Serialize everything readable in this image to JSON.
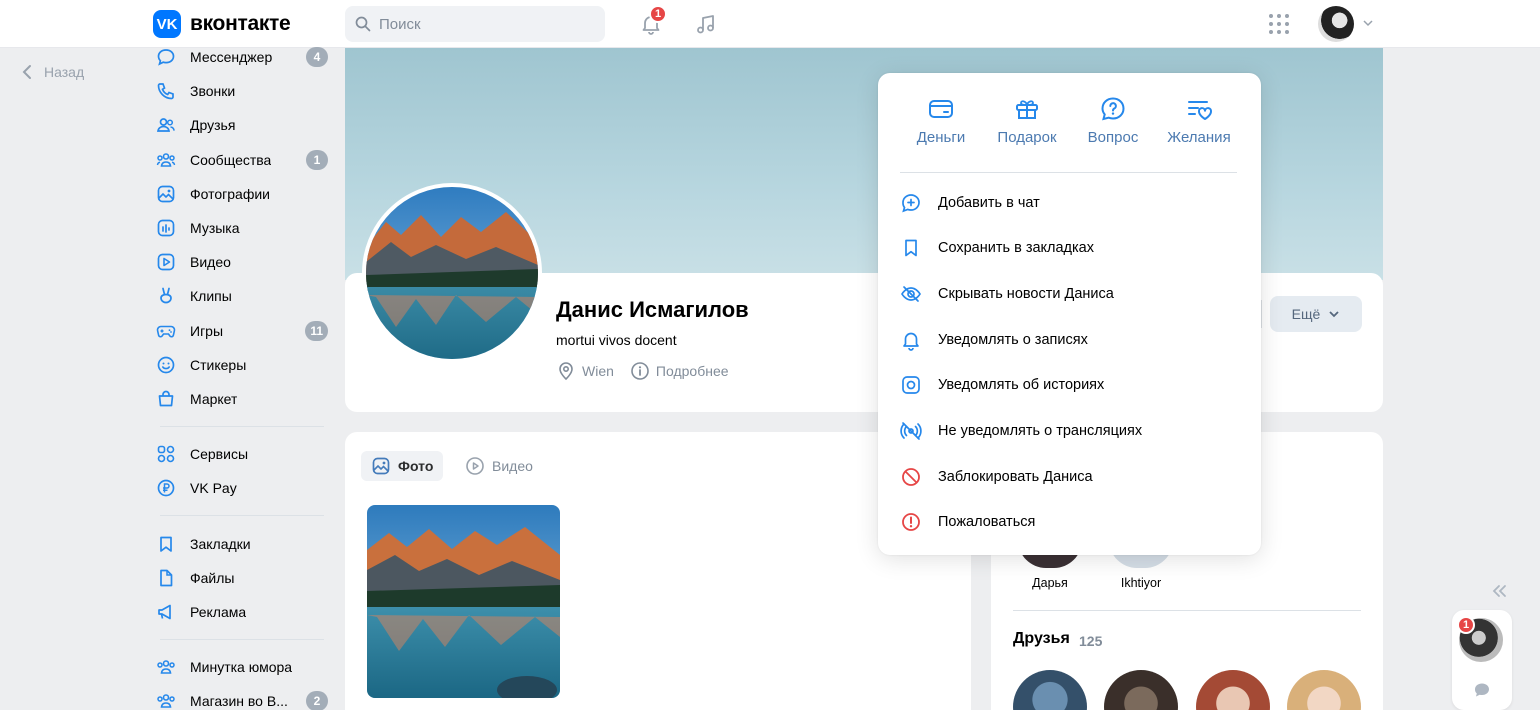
{
  "header": {
    "logo_mark": "VK",
    "logo_text": "вконтакте",
    "search_placeholder": "Поиск",
    "notifications_count": "1"
  },
  "back_label": "Назад",
  "sidebar": {
    "items": [
      {
        "label": "Мессенджер",
        "count": "4",
        "icon": "message-icon"
      },
      {
        "label": "Звонки",
        "count": "",
        "icon": "phone-icon"
      },
      {
        "label": "Друзья",
        "count": "",
        "icon": "friends-icon"
      },
      {
        "label": "Сообщества",
        "count": "1",
        "icon": "communities-icon"
      },
      {
        "label": "Фотографии",
        "count": "",
        "icon": "photo-icon"
      },
      {
        "label": "Музыка",
        "count": "",
        "icon": "music-icon"
      },
      {
        "label": "Видео",
        "count": "",
        "icon": "video-icon"
      },
      {
        "label": "Клипы",
        "count": "",
        "icon": "clips-icon"
      },
      {
        "label": "Игры",
        "count": "11",
        "icon": "games-icon"
      },
      {
        "label": "Стикеры",
        "count": "",
        "icon": "stickers-icon"
      },
      {
        "label": "Маркет",
        "count": "",
        "icon": "market-icon"
      }
    ],
    "services": [
      {
        "label": "Сервисы",
        "icon": "services-icon"
      },
      {
        "label": "VK Pay",
        "icon": "vkpay-icon"
      }
    ],
    "personal": [
      {
        "label": "Закладки",
        "icon": "bookmark-icon"
      },
      {
        "label": "Файлы",
        "icon": "files-icon"
      },
      {
        "label": "Реклама",
        "icon": "ads-icon"
      }
    ],
    "groups": [
      {
        "label": "Минутка юмора",
        "count": "",
        "icon": "group-icon"
      },
      {
        "label": "Магазин во В...",
        "count": "2",
        "icon": "group-icon"
      }
    ]
  },
  "profile": {
    "name": "Данис Исмагилов",
    "status": "mortui vivos docent",
    "city": "Wien",
    "details_label": "Подробнее",
    "more_button": "Ещё"
  },
  "tabs": {
    "photo": "Фото",
    "video": "Видео"
  },
  "right_panel": {
    "mini_friends": [
      "Дарья",
      "Ikhtiyor"
    ],
    "friends_title": "Друзья",
    "friends_count": "125"
  },
  "dropdown": {
    "top_actions": [
      {
        "label": "Деньги",
        "icon": "money-icon"
      },
      {
        "label": "Подарок",
        "icon": "gift-icon"
      },
      {
        "label": "Вопрос",
        "icon": "question-icon"
      },
      {
        "label": "Желания",
        "icon": "wishlist-icon"
      }
    ],
    "items": [
      {
        "label": "Добавить в чат",
        "icon": "add-chat-icon"
      },
      {
        "label": "Сохранить в закладках",
        "icon": "bookmark-icon"
      },
      {
        "label": "Скрывать новости Даниса",
        "icon": "hide-icon"
      },
      {
        "label": "Уведомлять о записях",
        "icon": "bell-icon"
      },
      {
        "label": "Уведомлять об историях",
        "icon": "stories-icon"
      },
      {
        "label": "Не уведомлять о трансляциях",
        "icon": "no-broadcast-icon"
      },
      {
        "label": "Заблокировать Даниса",
        "icon": "block-icon"
      },
      {
        "label": "Пожаловаться",
        "icon": "report-icon"
      }
    ]
  },
  "chat_widget": {
    "unread": "1"
  },
  "colors": {
    "accent": "#2688eb",
    "background": "#edeef0",
    "danger": "#e64646",
    "icon_blue": "#3f8ae0"
  }
}
